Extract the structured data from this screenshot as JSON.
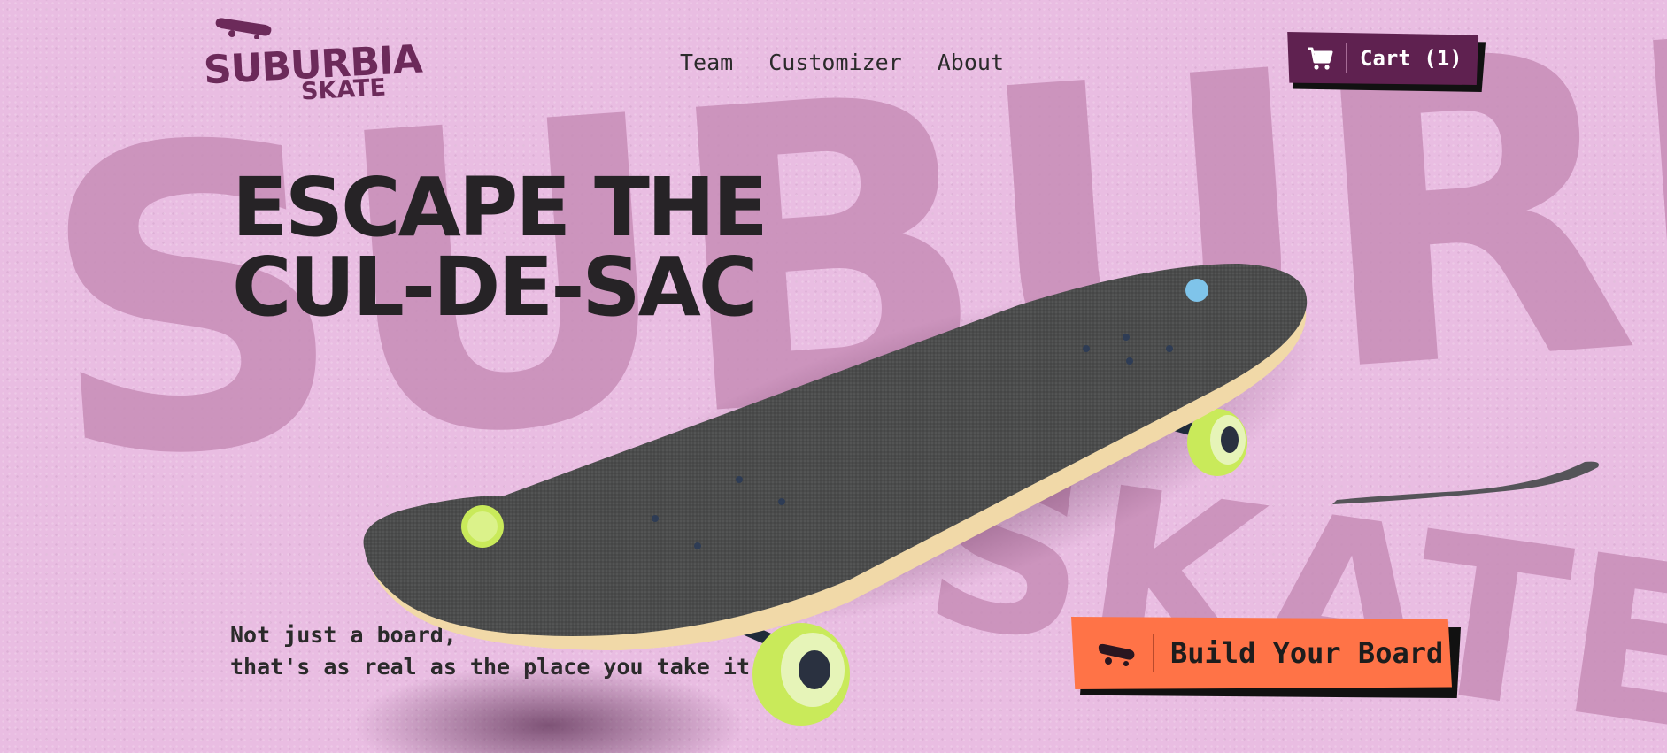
{
  "brand": {
    "logo_line1": "SUBURBIA",
    "logo_line2": "SKATE",
    "background_word_1": "SUBURBIA",
    "background_word_2": "SKATE"
  },
  "nav": {
    "items": [
      {
        "label": "Team"
      },
      {
        "label": "Customizer"
      },
      {
        "label": "About"
      }
    ]
  },
  "cart": {
    "label": "Cart (1)",
    "icon": "cart-icon"
  },
  "hero": {
    "title_line1": "ESCAPE THE",
    "title_line2": "CUL-DE-SAC",
    "tagline_line1": "Not just a board, ",
    "tagline_line2": "that's as real as the place you take it"
  },
  "cta": {
    "label": "Build Your Board",
    "icon": "skateboard-icon"
  },
  "colors": {
    "background": "#e9bde2",
    "background_word": "#c78db7",
    "brand_purple": "#5f2150",
    "cta_orange": "#ff7347",
    "wheel_green": "#c9ea5a",
    "bolt_blue": "#7fc4ea"
  }
}
